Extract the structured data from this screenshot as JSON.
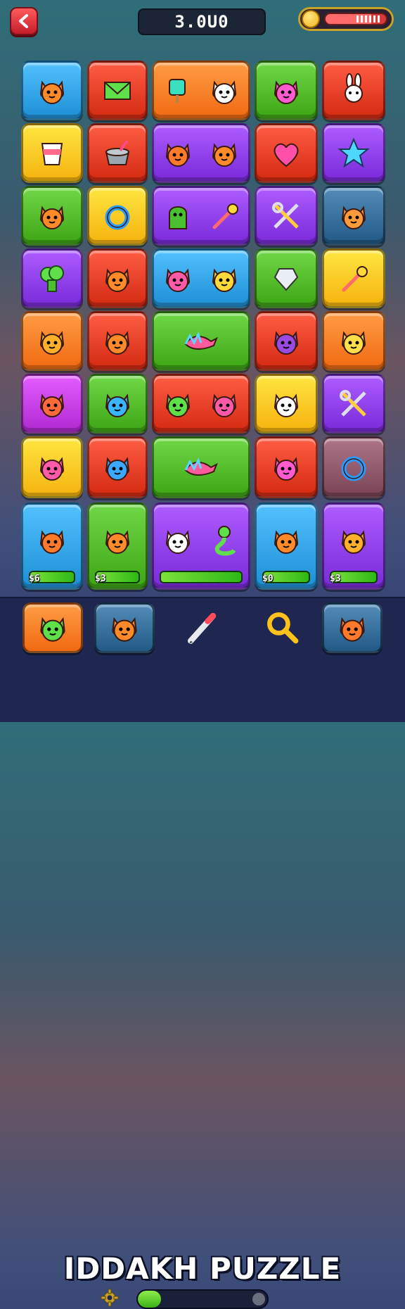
{
  "header": {
    "back_icon": "chevron-left-icon",
    "score": "3.0U0",
    "energy_level": 0.75
  },
  "tiles": [
    {
      "row": 0,
      "col": 0,
      "span": 1,
      "color": "#1f8fd6",
      "icons": [
        "cat-face-icon"
      ]
    },
    {
      "row": 0,
      "col": 1,
      "span": 1,
      "color": "#d42a12",
      "icons": [
        "envelope-icon"
      ]
    },
    {
      "row": 0,
      "col": 2,
      "span": 1.5,
      "color": "#f06a12",
      "icons": [
        "popsicle-block-icon",
        "white-cat-face-icon"
      ]
    },
    {
      "row": 0,
      "col": 3,
      "span": 1,
      "color": "#3ea615",
      "icons": [
        "spiky-creature-icon"
      ]
    },
    {
      "row": 0,
      "col": 4,
      "span": 1,
      "color": "#d42a12",
      "icons": [
        "bunny-icon"
      ]
    },
    {
      "row": 1,
      "col": 0,
      "span": 1,
      "color": "#f5b30e",
      "icons": [
        "cup-icon"
      ]
    },
    {
      "row": 1,
      "col": 1,
      "span": 1,
      "color": "#d42a12",
      "icons": [
        "pot-icon"
      ]
    },
    {
      "row": 1,
      "col": 2,
      "span": 1.5,
      "color": "#7a2ad8",
      "icons": [
        "fox-face-icon",
        "fox-lollipop-icon"
      ]
    },
    {
      "row": 1,
      "col": 3,
      "span": 1,
      "color": "#d42a12",
      "icons": [
        "heart-icon"
      ]
    },
    {
      "row": 1,
      "col": 4,
      "span": 1,
      "color": "#7a2ad8",
      "icons": [
        "star-icon"
      ]
    },
    {
      "row": 2,
      "col": 0,
      "span": 1,
      "color": "#3ea615",
      "icons": [
        "cat-face-icon"
      ]
    },
    {
      "row": 2,
      "col": 1,
      "span": 1,
      "color": "#f5b30e",
      "icons": [
        "ring-bottle-icon"
      ]
    },
    {
      "row": 2,
      "col": 2,
      "span": 1.5,
      "color": "#7a2ad8",
      "icons": [
        "ghost-icon",
        "lollipop-icon"
      ]
    },
    {
      "row": 2,
      "col": 3,
      "span": 1,
      "color": "#7a2ad8",
      "icons": [
        "scissors-icon"
      ]
    },
    {
      "row": 2,
      "col": 4,
      "span": 1,
      "color": "#215a86",
      "icons": [
        "bear-face-icon"
      ]
    },
    {
      "row": 3,
      "col": 0,
      "span": 1,
      "color": "#7a2ad8",
      "icons": [
        "broccoli-icon"
      ]
    },
    {
      "row": 3,
      "col": 1,
      "span": 1,
      "color": "#d42a12",
      "icons": [
        "cat-face-icon"
      ]
    },
    {
      "row": 3,
      "col": 2,
      "span": 1.5,
      "color": "#1f8fd6",
      "icons": [
        "pink-cat-face-icon",
        "yellow-cat-face-icon"
      ]
    },
    {
      "row": 3,
      "col": 3,
      "span": 1,
      "color": "#3ea615",
      "icons": [
        "diamond-squid-icon"
      ]
    },
    {
      "row": 3,
      "col": 4,
      "span": 1,
      "color": "#f5b30e",
      "icons": [
        "match-stick-icon"
      ]
    },
    {
      "row": 4,
      "col": 0,
      "span": 1,
      "color": "#f06a12",
      "icons": [
        "sun-face-icon"
      ]
    },
    {
      "row": 4,
      "col": 1,
      "span": 1,
      "color": "#d42a12",
      "icons": [
        "cat-lollipop-icon"
      ]
    },
    {
      "row": 4,
      "col": 2,
      "span": 1.5,
      "color": "#3ea615",
      "icons": [
        "feather-bird-icon"
      ]
    },
    {
      "row": 4,
      "col": 3,
      "span": 1,
      "color": "#d42a12",
      "icons": [
        "purple-cat-face-icon"
      ]
    },
    {
      "row": 4,
      "col": 4,
      "span": 1,
      "color": "#f06a12",
      "icons": [
        "smiley-face-icon"
      ]
    },
    {
      "row": 5,
      "col": 0,
      "span": 1,
      "color": "#b02ad0",
      "icons": [
        "star-face-icon"
      ]
    },
    {
      "row": 5,
      "col": 1,
      "span": 1,
      "color": "#3ea615",
      "icons": [
        "blob-icon"
      ]
    },
    {
      "row": 5,
      "col": 2,
      "span": 1.5,
      "color": "#d42a12",
      "icons": [
        "green-blob-icon",
        "pink-cat-face-icon"
      ]
    },
    {
      "row": 5,
      "col": 3,
      "span": 1,
      "color": "#f5b30e",
      "icons": [
        "white-cat-face-icon"
      ]
    },
    {
      "row": 5,
      "col": 4,
      "span": 1,
      "color": "#7a2ad8",
      "icons": [
        "crossed-swords-icon"
      ]
    },
    {
      "row": 6,
      "col": 0,
      "span": 1,
      "color": "#f5b30e",
      "icons": [
        "pink-blob-icon"
      ]
    },
    {
      "row": 6,
      "col": 1,
      "span": 1,
      "color": "#d42a12",
      "icons": [
        "blue-creature-icon"
      ]
    },
    {
      "row": 6,
      "col": 2,
      "span": 1.5,
      "color": "#3ea615",
      "icons": [
        "rainbow-bird-icon"
      ]
    },
    {
      "row": 6,
      "col": 3,
      "span": 1,
      "color": "#d42a12",
      "icons": [
        "spiky-creature-icon"
      ]
    },
    {
      "row": 6,
      "col": 4,
      "span": 1,
      "color": "#7a4456",
      "icons": [
        "donut-icon"
      ]
    },
    {
      "row": 7,
      "col": 0,
      "span": 1,
      "color": "#1f8fd6",
      "icons": [
        "fox-face-icon"
      ],
      "price": "$6"
    },
    {
      "row": 7,
      "col": 1,
      "span": 1,
      "color": "#3ea615",
      "icons": [
        "cat-face-icon"
      ],
      "price": "$3"
    },
    {
      "row": 7,
      "col": 2,
      "span": 1.5,
      "color": "#7a2ad8",
      "icons": [
        "white-cat-icon",
        "snake-icon"
      ],
      "price": ""
    },
    {
      "row": 7,
      "col": 3,
      "span": 1,
      "color": "#1f8fd6",
      "icons": [
        "cat-face-icon"
      ],
      "price": "$0"
    },
    {
      "row": 7,
      "col": 4,
      "span": 1,
      "color": "#7a2ad8",
      "icons": [
        "sun-face-icon"
      ],
      "price": "$3"
    }
  ],
  "dock": {
    "slots": [
      {
        "color": "#f06a12",
        "icon": "green-blob-icon"
      },
      {
        "color": "#215a86",
        "icon": "cat-face-icon"
      },
      {
        "tool": "pencil-icon"
      },
      {
        "tool": "magnifier-icon"
      },
      {
        "color": "#215a86",
        "icon": "orange-creature-icon"
      }
    ],
    "title": "IDDAKH PUZZLE",
    "settings_icon": "gear-icon",
    "progress": 0.1
  }
}
